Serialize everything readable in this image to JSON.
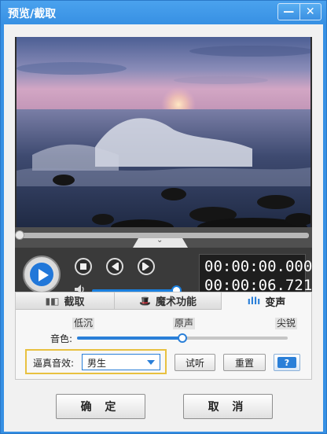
{
  "window": {
    "title": "预览/截取",
    "minimize": "—",
    "close": "✕"
  },
  "player": {
    "time_current": "00:00:00.000",
    "time_total": "00:00:06.721",
    "progress": 0,
    "volume": 0.95,
    "collapse_glyph": "⌄"
  },
  "tabs": [
    {
      "label": "截取",
      "icon": "crop-icon",
      "glyph": "▮◧"
    },
    {
      "label": "魔术功能",
      "icon": "magic-hat-icon",
      "glyph": "🎩"
    },
    {
      "label": "变声",
      "icon": "sound-wave-icon",
      "glyph": "ıllı"
    }
  ],
  "voice_change": {
    "pitch_label": "音色:",
    "scale_low": "低沉",
    "scale_mid": "原声",
    "scale_high": "尖锐",
    "pitch_value": 0.5,
    "preset_label": "逼真音效:",
    "preset_value": "男生",
    "audition_button": "试听",
    "reset_button": "重置",
    "help_glyph": "?"
  },
  "footer": {
    "ok": "确 定",
    "cancel": "取 消"
  },
  "colors": {
    "titlebar": "#3690e4",
    "accent": "#2a7fd8",
    "highlight": "#e8c140"
  }
}
